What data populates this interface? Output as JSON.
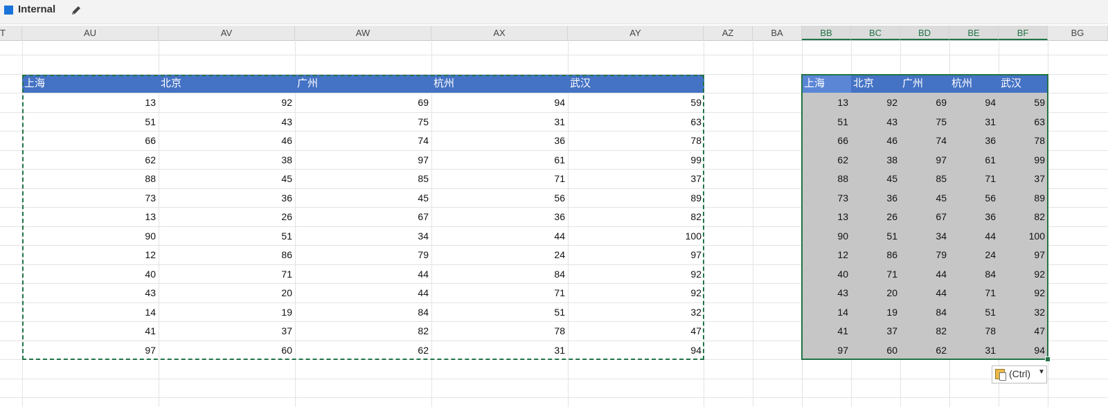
{
  "topbar": {
    "sensitivity_label": "Internal"
  },
  "columns": [
    "T",
    "AU",
    "AV",
    "AW",
    "AX",
    "AY",
    "AZ",
    "BA",
    "BB",
    "BC",
    "BD",
    "BE",
    "BF",
    "BG"
  ],
  "table": {
    "headers": [
      "上海",
      "北京",
      "广州",
      "杭州",
      "武汉"
    ],
    "rows": [
      [
        "13",
        "92",
        "69",
        "94",
        "59"
      ],
      [
        "51",
        "43",
        "75",
        "31",
        "63"
      ],
      [
        "66",
        "46",
        "74",
        "36",
        "78"
      ],
      [
        "62",
        "38",
        "97",
        "61",
        "99"
      ],
      [
        "88",
        "45",
        "85",
        "71",
        "37"
      ],
      [
        "73",
        "36",
        "45",
        "56",
        "89"
      ],
      [
        "13",
        "26",
        "67",
        "36",
        "82"
      ],
      [
        "90",
        "51",
        "34",
        "44",
        "100"
      ],
      [
        "12",
        "86",
        "79",
        "24",
        "97"
      ],
      [
        "40",
        "71",
        "44",
        "84",
        "92"
      ],
      [
        "43",
        "20",
        "44",
        "71",
        "92"
      ],
      [
        "14",
        "19",
        "84",
        "51",
        "32"
      ],
      [
        "41",
        "37",
        "82",
        "78",
        "47"
      ],
      [
        "97",
        "60",
        "62",
        "31",
        "94"
      ]
    ]
  },
  "paste_options": {
    "label": "(Ctrl)"
  },
  "colors": {
    "header_fill": "#4472c4",
    "selection": "#217346",
    "pasted_fill": "#c6c6c6"
  }
}
